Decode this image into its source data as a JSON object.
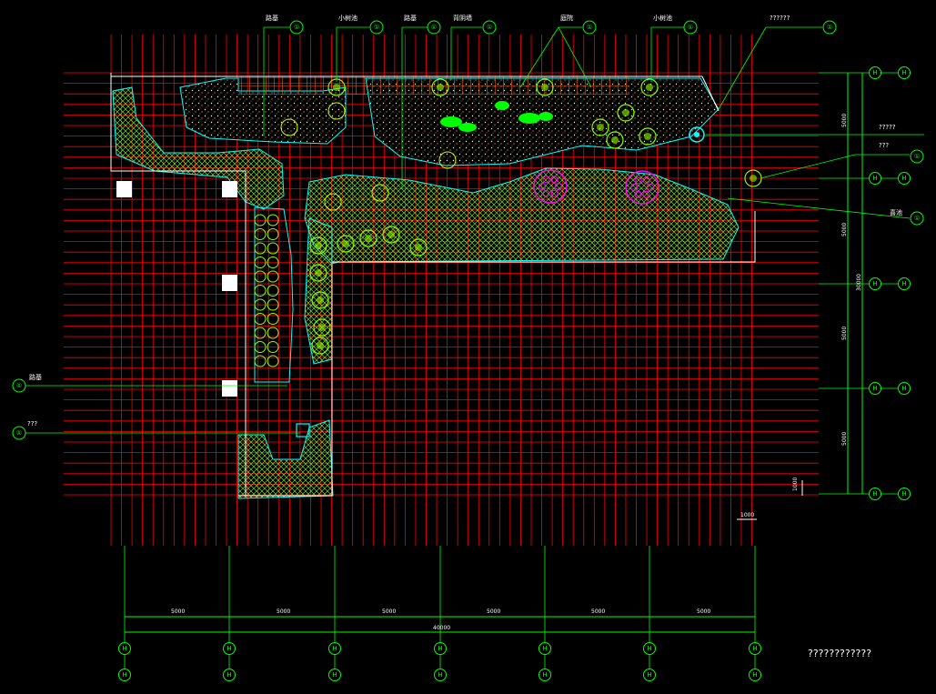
{
  "drawing": {
    "title": "????????????",
    "background": "#000000",
    "colors": {
      "grid": "#ff0000",
      "leader": "#00ff00",
      "outline": "#ffffff",
      "edge": "#00ffff",
      "hatch": "#00ff00",
      "shrub": "#88ff00",
      "flower": "#ff00ff",
      "text": "#ffffff",
      "plaza": "#ff4444"
    }
  },
  "callouts_top": [
    {
      "text": "路基",
      "tag": "①"
    },
    {
      "text": "小树池",
      "tag": "①"
    },
    {
      "text": "路基",
      "tag": "①"
    },
    {
      "text": "背阴墙",
      "tag": "①"
    },
    {
      "text": "庭院",
      "tag": "①"
    },
    {
      "text": "小树池",
      "tag": "①"
    },
    {
      "text": "??????",
      "tag": "①"
    }
  ],
  "callouts_right": [
    {
      "text": "?????",
      "tag": ""
    },
    {
      "text": "???",
      "tag": "①"
    },
    {
      "text": "喜池",
      "tag": "①"
    }
  ],
  "callouts_left": [
    {
      "text": "路基",
      "tag": "①"
    },
    {
      "text": "???",
      "tag": "①"
    }
  ],
  "dimensions": {
    "bottom_segments": [
      "5000",
      "5000",
      "5000",
      "5000",
      "5000",
      "5000"
    ],
    "bottom_total": "40000",
    "right_segments": [
      "5000",
      "5000",
      "5000",
      "5000"
    ],
    "right_total": "30000",
    "scale_small": "1000",
    "scale_small_vertical": "1000"
  },
  "axis_bubbles": {
    "bottom_row1": [
      "H",
      "H",
      "H",
      "H",
      "H",
      "H",
      "H"
    ],
    "bottom_row2": [
      "H",
      "H",
      "H",
      "H",
      "H",
      "H",
      "H"
    ],
    "right_inner": [
      "H",
      "H",
      "H",
      "H",
      "H"
    ],
    "right_outer": [
      "H",
      "H",
      "H",
      "H",
      "H"
    ]
  }
}
